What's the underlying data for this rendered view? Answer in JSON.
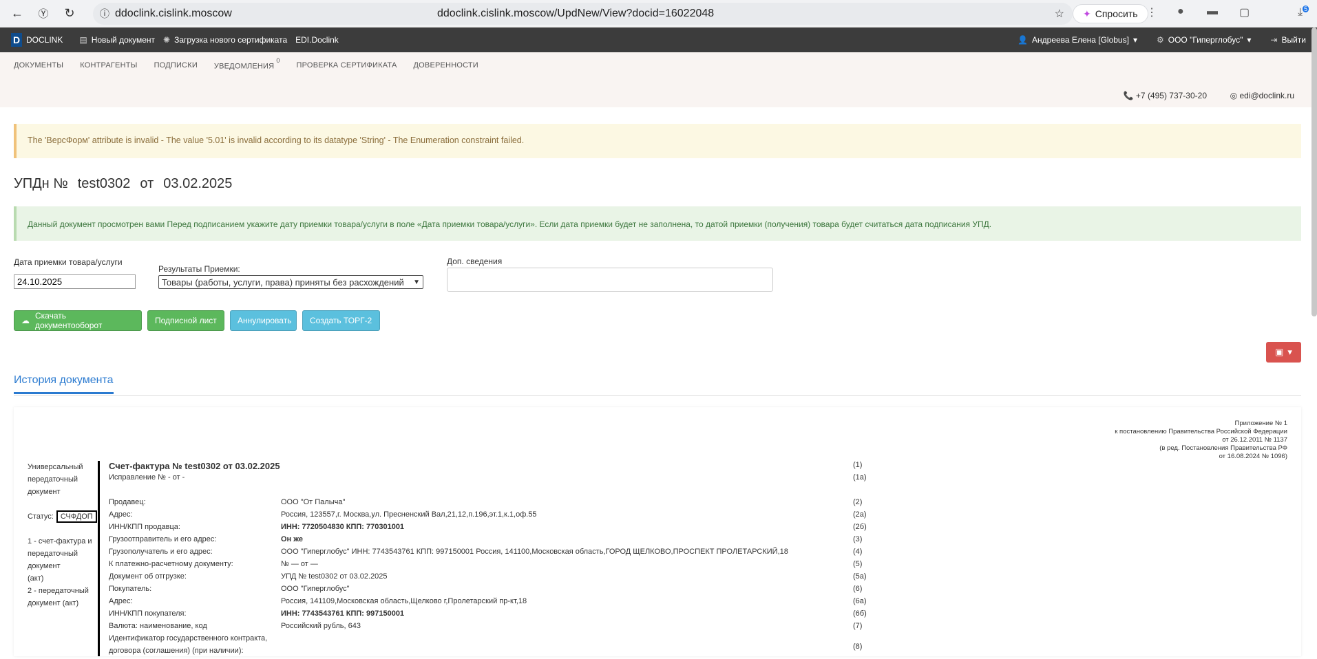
{
  "browser": {
    "host": "ddoclink.cislink.moscow",
    "url": "ddoclink.cislink.moscow/UpdNew/View?docid=16022048",
    "ask_label": "Спросить",
    "downloads_badge": "5"
  },
  "appbar": {
    "brand": "DOCLINK",
    "new_doc": "Новый документ",
    "upload_cert": "Загрузка нового сертификата",
    "edi": "EDI.Doclink",
    "user": "Андреева Елена [Globus]",
    "org": "ООО \"Гиперглобус\"",
    "logout": "Выйти"
  },
  "mainnav": {
    "tabs": [
      "ДОКУМЕНТЫ",
      "КОНТРАГЕНТЫ",
      "ПОДПИСКИ",
      "УВЕДОМЛЕНИЯ",
      "ПРОВЕРКА СЕРТИФИКАТА",
      "ДОВЕРЕННОСТИ"
    ],
    "notif_count": "0"
  },
  "contacts": {
    "phone": "+7 (495) 737-30-20",
    "email": "edi@doclink.ru"
  },
  "warning": "The 'ВерсФорм' attribute is invalid - The value '5.01' is invalid according to its datatype 'String' - The Enumeration constraint failed.",
  "title": {
    "type": "УПДн №",
    "number": "test0302",
    "from": "от",
    "date": "03.02.2025"
  },
  "info": "Данный документ просмотрен вами  Перед подписанием укажите дату приемки товара/услуги в поле «Дата приемки товара/услуги». Если дата приемки будет не заполнена, то датой приемки (получения) товара будет считаться дата подписания УПД.",
  "form": {
    "date_label": "Дата приемки товара/услуги",
    "date_value": "24.10.2025",
    "result_label": "Результаты Приемки:",
    "result_value": "Товары (работы, услуги, права) приняты без расхождений",
    "extra_label": "Доп. сведения",
    "extra_value": ""
  },
  "buttons": {
    "download": "Скачать документооборот",
    "sign_sheet": "Подписной лист",
    "cancel": "Аннулировать",
    "torg": "Создать ТОРГ-2"
  },
  "history_tab": "История документа",
  "doc": {
    "appendix": [
      "Приложение № 1",
      "к постановлению Правительства Российской Федерации",
      "от 26.12.2011 № 1137",
      "(в ред. Постановления Правительства РФ",
      "от 16.08.2024 № 1096)"
    ],
    "left": {
      "l1": "Универсальный",
      "l2": "передаточный",
      "l3": "документ",
      "status_label": "Статус:",
      "status_value": "СЧФДОП",
      "n1a": "1 - счет-фактура и",
      "n1b": "передаточный",
      "n1c": "документ",
      "n1d": "(акт)",
      "n2a": "2 - передаточный",
      "n2b": "документ (акт)"
    },
    "heading": "Счет-фактура № test0302  от 03.02.2025",
    "correction": "Исправление № - от -",
    "rows": [
      {
        "k": "Продавец:",
        "v": "ООО \"От Палыча\"",
        "n": "(2)"
      },
      {
        "k": "Адрес:",
        "v": "Россия, 123557,г. Москва,ул. Пресненский Вал,21,12,п.196,эт.1,к.1,оф.55",
        "n": "(2а)"
      },
      {
        "k": "ИНН/КПП продавца:",
        "v": "ИНН: 7720504830 КПП: 770301001",
        "n": "(2б)"
      },
      {
        "k": "Грузоотправитель и его адрес:",
        "v": "Он же",
        "n": "(3)"
      },
      {
        "k": "Грузополучатель и его адрес:",
        "v": "ООО \"Гиперглобус\" ИНН: 7743543761 КПП: 997150001 Россия, 141100,Московская область,ГОРОД ЩЕЛКОВО,ПРОСПЕКТ ПРОЛЕТАРСКИЙ,18",
        "n": "(4)"
      },
      {
        "k": "К платежно-расчетному документу:",
        "v": "№   — от  —",
        "n": "(5)"
      },
      {
        "k": "Документ об отгрузке:",
        "v": "УПД  № test0302  от 03.02.2025",
        "n": "(5а)"
      },
      {
        "k": "Покупатель:",
        "v": "ООО \"Гиперглобус\"",
        "n": "(6)"
      },
      {
        "k": "Адрес:",
        "v": "Россия, 141109,Московская область,Щелково г,Пролетарский пр-кт,18",
        "n": "(6а)"
      },
      {
        "k": "ИНН/КПП покупателя:",
        "v": "ИНН: 7743543761 КПП: 997150001",
        "n": "(6б)"
      },
      {
        "k": "Валюта: наименование, код",
        "v": "Российский рубль,  643",
        "n": "(7)"
      }
    ],
    "gov_id_1": "Идентификатор государственного контракта,",
    "gov_id_2": "договора (соглашения) (при наличии):",
    "n1": "(1)",
    "n1a_num": "(1а)",
    "n8": "(8)"
  }
}
